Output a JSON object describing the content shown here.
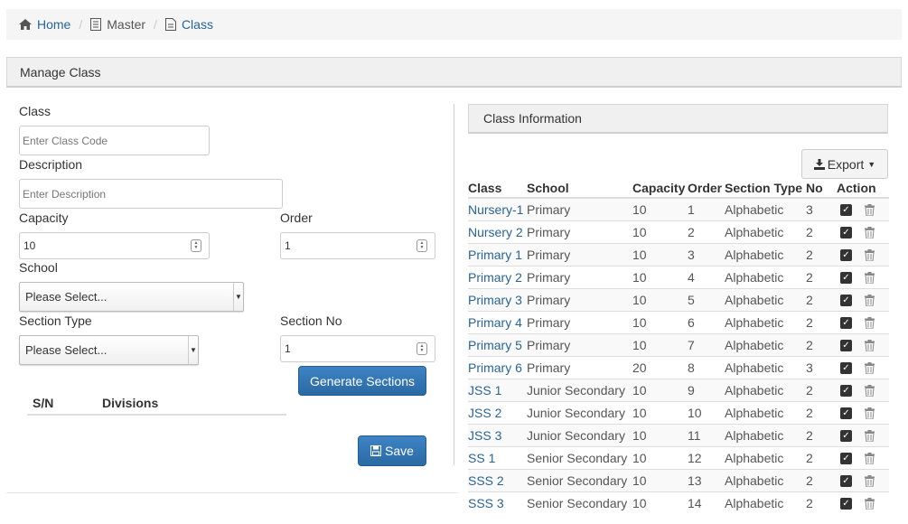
{
  "breadcrumb": {
    "home": "Home",
    "master": "Master",
    "class": "Class"
  },
  "panel": {
    "title": "Manage Class"
  },
  "form": {
    "class_label": "Class",
    "class_placeholder": "Enter Class Code",
    "description_label": "Description",
    "description_placeholder": "Enter Description",
    "capacity_label": "Capacity",
    "capacity_value": "10",
    "order_label": "Order",
    "order_value": "1",
    "school_label": "School",
    "school_value": "Please Select...",
    "section_type_label": "Section Type",
    "section_type_value": "Please Select...",
    "section_no_label": "Section No",
    "section_no_value": "1",
    "generate_button": "Generate Sections",
    "sn_header": "S/N",
    "divisions_header": "Divisions",
    "save_button": "Save"
  },
  "class_info": {
    "title": "Class Information",
    "export_button": "Export",
    "columns": [
      "Class",
      "School",
      "Capacity",
      "Order",
      "Section Type",
      "No",
      "Action"
    ],
    "rows": [
      {
        "class": "Nursery-1",
        "school": "Primary",
        "capacity": "10",
        "order": "1",
        "section_type": "Alphabetic",
        "no": "3"
      },
      {
        "class": "Nursery 2",
        "school": "Primary",
        "capacity": "10",
        "order": "2",
        "section_type": "Alphabetic",
        "no": "2"
      },
      {
        "class": "Primary 1",
        "school": "Primary",
        "capacity": "10",
        "order": "3",
        "section_type": "Alphabetic",
        "no": "2"
      },
      {
        "class": "Primary 2",
        "school": "Primary",
        "capacity": "10",
        "order": "4",
        "section_type": "Alphabetic",
        "no": "2"
      },
      {
        "class": "Primary 3",
        "school": "Primary",
        "capacity": "10",
        "order": "5",
        "section_type": "Alphabetic",
        "no": "2"
      },
      {
        "class": "Primary 4",
        "school": "Primary",
        "capacity": "10",
        "order": "6",
        "section_type": "Alphabetic",
        "no": "2"
      },
      {
        "class": "Primary 5",
        "school": "Primary",
        "capacity": "10",
        "order": "7",
        "section_type": "Alphabetic",
        "no": "2"
      },
      {
        "class": "Primary 6",
        "school": "Primary",
        "capacity": "20",
        "order": "8",
        "section_type": "Alphabetic",
        "no": "3"
      },
      {
        "class": "JSS 1",
        "school": "Junior Secondary",
        "capacity": "10",
        "order": "9",
        "section_type": "Alphabetic",
        "no": "2"
      },
      {
        "class": "JSS 2",
        "school": "Junior Secondary",
        "capacity": "10",
        "order": "10",
        "section_type": "Alphabetic",
        "no": "2"
      },
      {
        "class": "JSS 3",
        "school": "Junior Secondary",
        "capacity": "10",
        "order": "11",
        "section_type": "Alphabetic",
        "no": "2"
      },
      {
        "class": "SS 1",
        "school": "Senior Secondary",
        "capacity": "10",
        "order": "12",
        "section_type": "Alphabetic",
        "no": "2"
      },
      {
        "class": "SSS 2",
        "school": "Senior Secondary",
        "capacity": "10",
        "order": "13",
        "section_type": "Alphabetic",
        "no": "2"
      },
      {
        "class": "SSS 3",
        "school": "Senior Secondary",
        "capacity": "10",
        "order": "14",
        "section_type": "Alphabetic",
        "no": "2"
      }
    ]
  },
  "icons": {
    "home": "home-icon",
    "master": "list-icon",
    "class": "file-icon",
    "export": "download-icon",
    "save": "floppy-icon",
    "edit": "checkbox-icon",
    "delete": "trash-icon"
  },
  "colors": {
    "link": "#2a6496",
    "primary_button": "#2a6aa5"
  }
}
